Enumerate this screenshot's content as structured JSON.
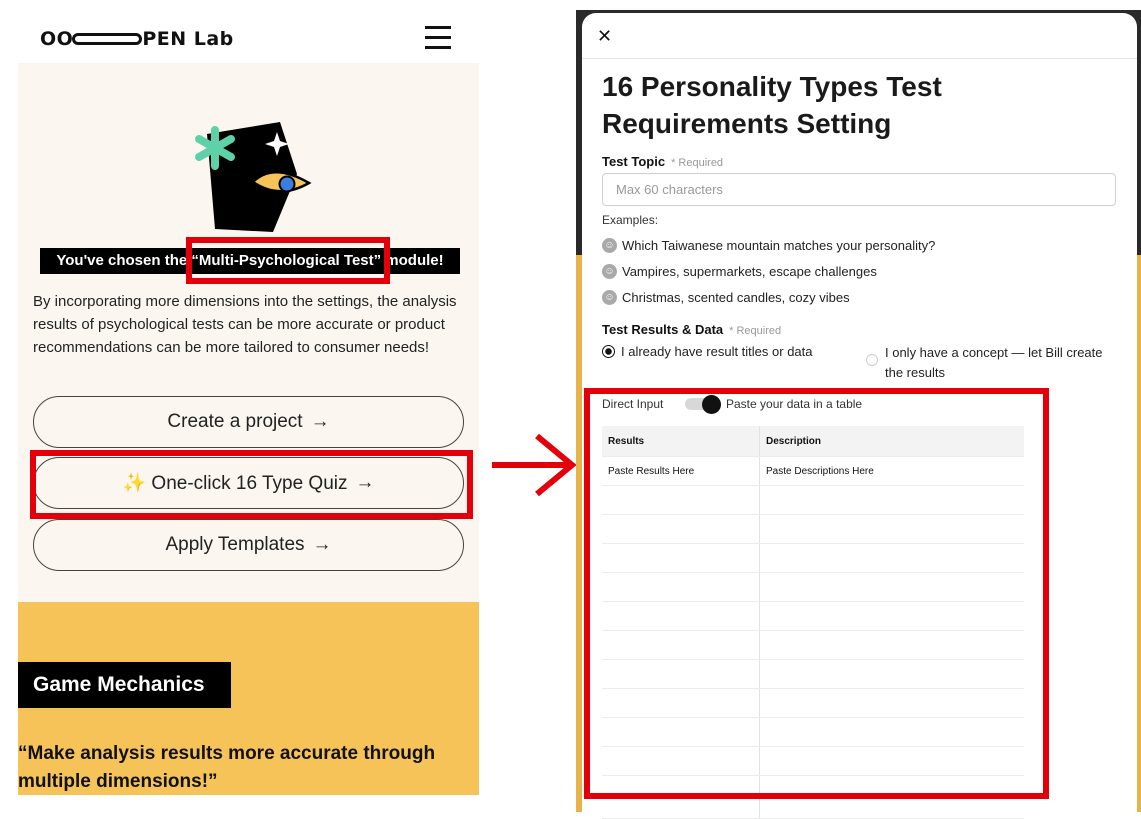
{
  "left": {
    "logo": {
      "prefix": "OO",
      "suffix": "PEN Lab"
    },
    "hero": {
      "chosen_before": "You've chosen the ",
      "chosen_module": "“Multi-Psychological Test”",
      "chosen_after": " module!",
      "description": "By incorporating more dimensions into the settings, the analysis results of psychological tests can be more accurate or product recommendations can be more tailored to consumer needs!"
    },
    "buttons": [
      {
        "label": "Create a project",
        "arrow": "→"
      },
      {
        "label": "✨ One-click 16 Type Quiz",
        "arrow": "→"
      },
      {
        "label": "Apply Templates",
        "arrow": "→"
      }
    ],
    "section": {
      "title": "Game Mechanics",
      "quote": "“Make analysis results more accurate through multiple dimensions!”"
    }
  },
  "right": {
    "close_icon": "✕",
    "title": "16 Personality Types Test Requirements Setting",
    "topic": {
      "label": "Test Topic",
      "required": "* Required",
      "placeholder": "Max 60 characters"
    },
    "examples_label": "Examples:",
    "examples": [
      "Which Taiwanese mountain matches your personality?",
      "Vampires, supermarkets, escape challenges",
      "Christmas, scented candles, cozy vibes"
    ],
    "results": {
      "label": "Test Results & Data",
      "required": "* Required",
      "option_a": "I already have result titles or data",
      "option_b": "I only have a concept — let Bill create the results"
    },
    "toggle": {
      "left_label": "Direct Input",
      "right_label": "Paste your data in a table"
    },
    "table": {
      "headers": [
        "Results",
        "Description"
      ],
      "first_row": [
        "Paste Results Here",
        "Paste Descriptions Here"
      ]
    }
  },
  "colors": {
    "accent_red": "#e3000b",
    "yellow": "#f6c358",
    "cream": "#fbf7f0",
    "teal": "#5fd1a8",
    "eye_blue": "#3b7de0"
  }
}
